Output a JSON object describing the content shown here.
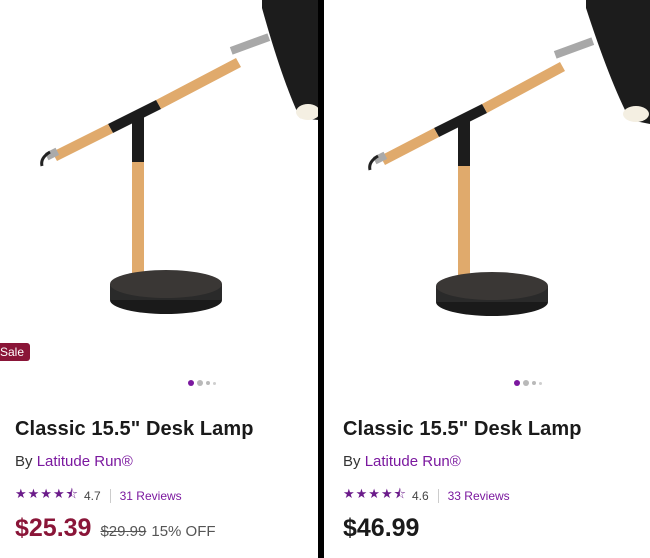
{
  "products": [
    {
      "badge": "Sale",
      "title": "Classic 15.5\" Desk Lamp",
      "by_prefix": "By",
      "brand": "Latitude Run®",
      "stars": "★★★★⯪",
      "rating": "4.7",
      "reviews": "31 Reviews",
      "price": "$25.39",
      "original_price": "$29.99",
      "discount": "15% OFF",
      "image_dots": 4,
      "active_dot": 0
    },
    {
      "title": "Classic 15.5\" Desk Lamp",
      "by_prefix": "By",
      "brand": "Latitude Run®",
      "stars": "★★★★⯪",
      "rating": "4.6",
      "reviews": "33 Reviews",
      "price": "$46.99",
      "image_dots": 4,
      "active_dot": 0
    }
  ],
  "colors": {
    "brand_purple": "#7b189f",
    "sale_red": "#8a1538",
    "wood": "#e0aa6c",
    "metal_black": "#1c1c1c"
  }
}
